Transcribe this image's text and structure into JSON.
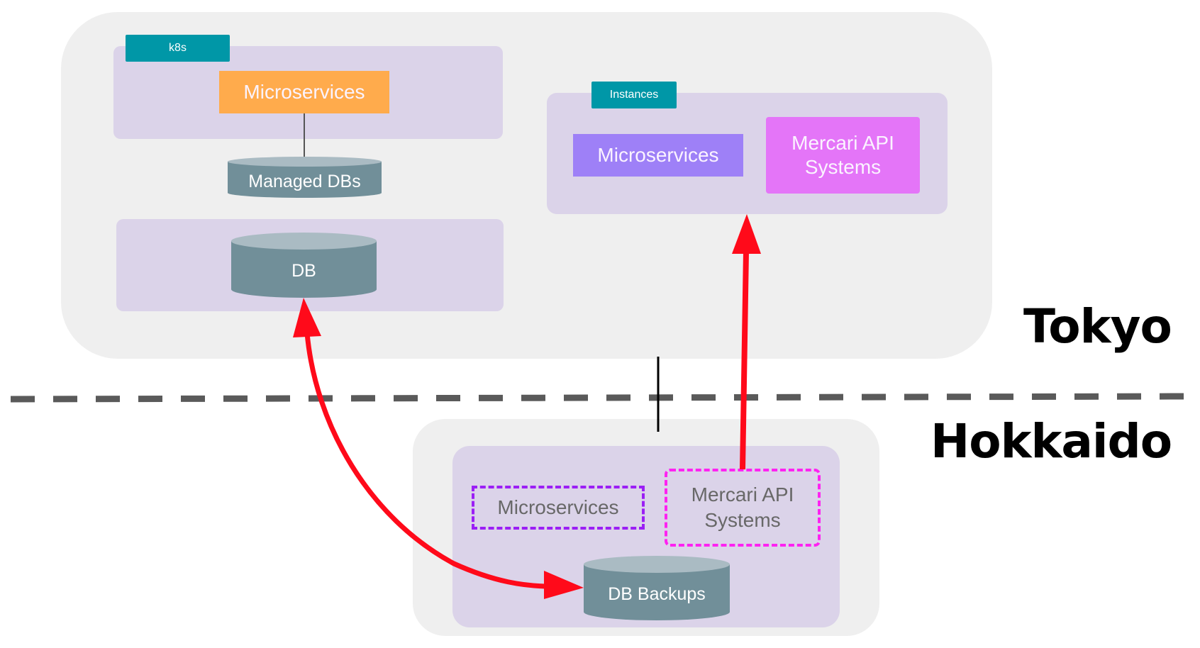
{
  "regions": {
    "tokyo": {
      "label": "Tokyo",
      "k8s_group": {
        "tag": "k8s",
        "microservices": "Microservices",
        "managed_dbs": "Managed DBs"
      },
      "db_group": {
        "db": "DB"
      },
      "instances_group": {
        "tag": "Instances",
        "microservices": "Microservices",
        "mercari_api_line1": "Mercari API",
        "mercari_api_line2": "Systems"
      }
    },
    "hokkaido": {
      "label": "Hokkaido",
      "microservices": "Microservices",
      "mercari_api_line1": "Mercari API",
      "mercari_api_line2": "Systems",
      "db_backups": "DB Backups"
    }
  },
  "connections": [
    {
      "from": "Managed DBs",
      "to": "k8s Microservices",
      "style": "solid-gray"
    },
    {
      "from": "DB (Tokyo)",
      "to": "DB Backups (Hokkaido)",
      "style": "red-bidirectional-arrow"
    },
    {
      "from": "Mercari API Systems (Hokkaido)",
      "to": "Instances (Tokyo)",
      "style": "red-arrow"
    },
    {
      "from": "Tokyo",
      "to": "Hokkaido",
      "style": "black-link"
    }
  ],
  "colors": {
    "region_bg": "#efefef",
    "group_bg": "#dbd3e9",
    "tag": "#0097a7",
    "orange_microservices": "#ffab4c",
    "purple_microservices": "#9e80f7",
    "pink_mercari": "#e475f8",
    "cylinder_body": "#718f99",
    "cylinder_top": "#aabbc3",
    "arrow_red": "#ff0a1a",
    "dashed_purple": "#9b1ff5",
    "dashed_pink": "#ff22f2",
    "divider": "#5a5a5a"
  }
}
